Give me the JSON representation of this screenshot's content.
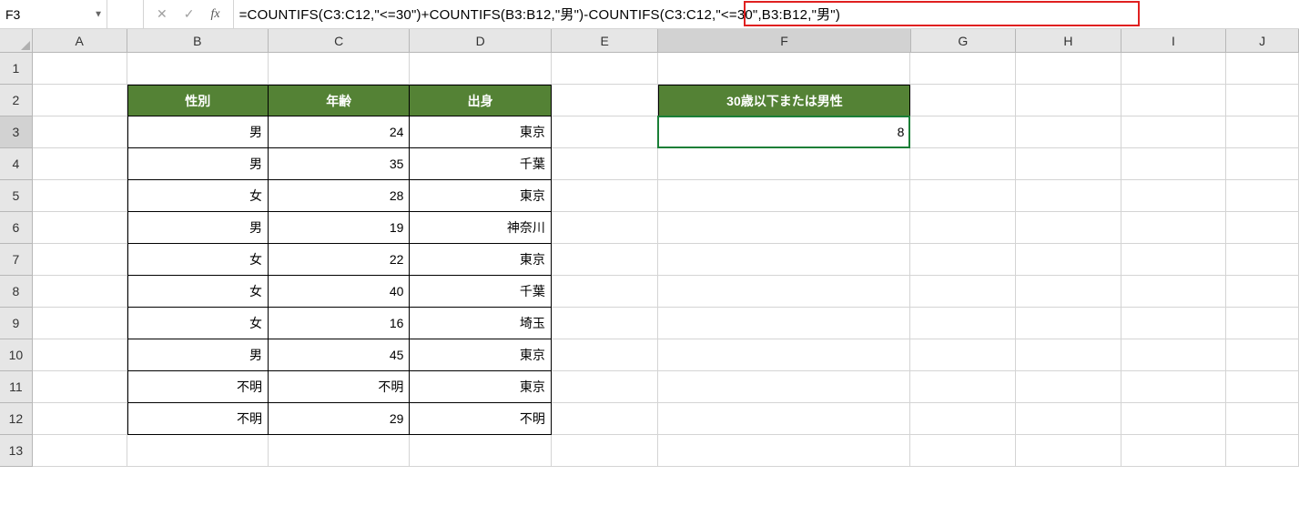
{
  "name_box": "F3",
  "formula": "=COUNTIFS(C3:C12,\"<=30\")+COUNTIFS(B3:B12,\"男\")-COUNTIFS(C3:C12,\"<=30\",B3:B12,\"男\")",
  "col_labels": [
    "A",
    "B",
    "C",
    "D",
    "E",
    "F",
    "G",
    "H",
    "I",
    "J"
  ],
  "row_labels": [
    "1",
    "2",
    "3",
    "4",
    "5",
    "6",
    "7",
    "8",
    "9",
    "10",
    "11",
    "12",
    "13"
  ],
  "table": {
    "headers": {
      "b": "性別",
      "c": "年齢",
      "d": "出身"
    },
    "rows": [
      {
        "b": "男",
        "c": "24",
        "d": "東京"
      },
      {
        "b": "男",
        "c": "35",
        "d": "千葉"
      },
      {
        "b": "女",
        "c": "28",
        "d": "東京"
      },
      {
        "b": "男",
        "c": "19",
        "d": "神奈川"
      },
      {
        "b": "女",
        "c": "22",
        "d": "東京"
      },
      {
        "b": "女",
        "c": "40",
        "d": "千葉"
      },
      {
        "b": "女",
        "c": "16",
        "d": "埼玉"
      },
      {
        "b": "男",
        "c": "45",
        "d": "東京"
      },
      {
        "b": "不明",
        "c": "不明",
        "d": "東京"
      },
      {
        "b": "不明",
        "c": "29",
        "d": "不明"
      }
    ]
  },
  "result_header": "30歳以下または男性",
  "result_value": "8",
  "icons": {
    "cancel": "✕",
    "enter": "✓",
    "fx": "fx",
    "dropdown": "▼"
  }
}
